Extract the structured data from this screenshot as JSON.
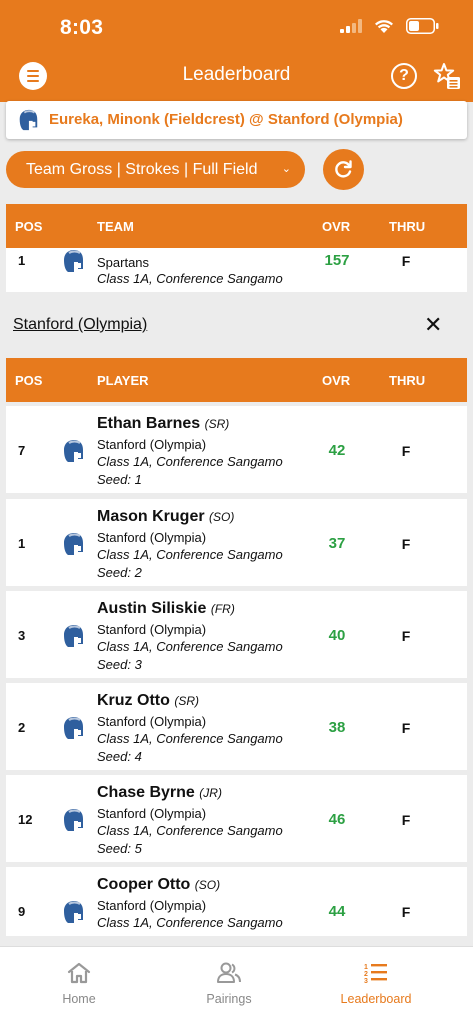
{
  "status_bar": {
    "time": "8:03"
  },
  "header": {
    "title": "Leaderboard",
    "help_symbol": "?"
  },
  "match": {
    "title": "Eureka, Minonk (Fieldcrest) @ Stanford (Olympia)"
  },
  "filter": {
    "label": "Team Gross | Strokes | Full Field"
  },
  "team_table": {
    "columns": {
      "pos": "POS",
      "team": "TEAM",
      "ovr": "OVR",
      "thru": "THRU"
    },
    "rows": [
      {
        "pos": "1",
        "mascot": "Spartans",
        "class_conf": "Class 1A, Conference Sangamo",
        "ovr": "157",
        "thru": "F"
      }
    ]
  },
  "team_section": {
    "team_name": "Stanford (Olympia)",
    "close_symbol": "✕"
  },
  "player_table": {
    "columns": {
      "pos": "POS",
      "player": "PLAYER",
      "ovr": "OVR",
      "thru": "THRU"
    },
    "rows": [
      {
        "pos": "7",
        "name": "Ethan Barnes",
        "class_year": "(SR)",
        "school": "Stanford (Olympia)",
        "class_conf": "Class 1A, Conference Sangamo",
        "seed": "Seed: 1",
        "ovr": "42",
        "thru": "F"
      },
      {
        "pos": "1",
        "name": "Mason Kruger",
        "class_year": "(SO)",
        "school": "Stanford (Olympia)",
        "class_conf": "Class 1A, Conference Sangamo",
        "seed": "Seed: 2",
        "ovr": "37",
        "thru": "F"
      },
      {
        "pos": "3",
        "name": "Austin Siliskie",
        "class_year": "(FR)",
        "school": "Stanford (Olympia)",
        "class_conf": "Class 1A, Conference Sangamo",
        "seed": "Seed: 3",
        "ovr": "40",
        "thru": "F"
      },
      {
        "pos": "2",
        "name": "Kruz Otto",
        "class_year": "(SR)",
        "school": "Stanford (Olympia)",
        "class_conf": "Class 1A, Conference Sangamo",
        "seed": "Seed: 4",
        "ovr": "38",
        "thru": "F"
      },
      {
        "pos": "12",
        "name": "Chase Byrne",
        "class_year": "(JR)",
        "school": "Stanford (Olympia)",
        "class_conf": "Class 1A, Conference Sangamo",
        "seed": "Seed: 5",
        "ovr": "46",
        "thru": "F"
      },
      {
        "pos": "9",
        "name": "Cooper Otto",
        "class_year": "(SO)",
        "school": "Stanford (Olympia)",
        "class_conf": "Class 1A, Conference Sangamo",
        "seed": "",
        "ovr": "44",
        "thru": "F"
      }
    ]
  },
  "tabbar": {
    "home": "Home",
    "pairings": "Pairings",
    "leaderboard": "Leaderboard"
  },
  "colors": {
    "accent": "#e77a1d",
    "score_green": "#2ca043",
    "logo_blue": "#2f5f9e"
  },
  "icons": {
    "menu": "hamburger-icon",
    "help": "help-circle-icon",
    "favorite": "star-list-icon",
    "refresh": "refresh-icon",
    "close": "close-icon",
    "team_logo": "spartan-helmet-icon"
  }
}
